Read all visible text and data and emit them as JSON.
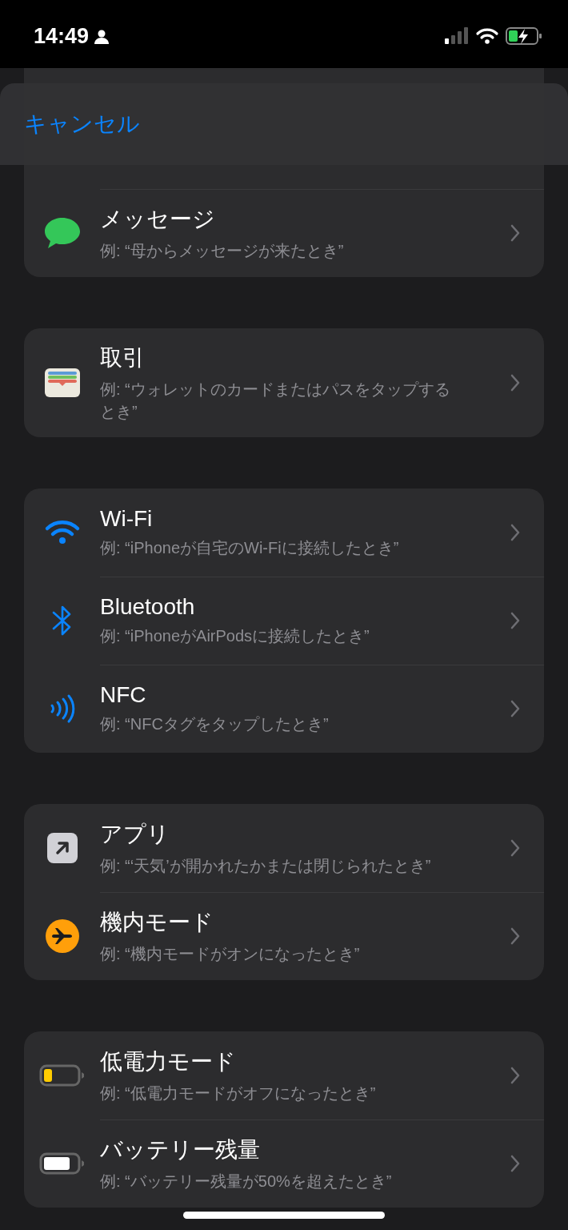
{
  "status_bar": {
    "time": "14:49"
  },
  "header": {
    "cancel": "キャンセル"
  },
  "groups": [
    {
      "rows": [
        {
          "kind": "message",
          "title": "メッセージ",
          "subtitle": "例: “母からメッセージが来たとき”"
        }
      ]
    },
    {
      "rows": [
        {
          "kind": "wallet",
          "title": "取引",
          "subtitle": "例: “ウォレットのカードまたはパスをタップするとき”"
        }
      ]
    },
    {
      "rows": [
        {
          "kind": "wifi",
          "title": "Wi-Fi",
          "subtitle": "例: “iPhoneが自宅のWi-Fiに接続したとき”"
        },
        {
          "kind": "bluetooth",
          "title": "Bluetooth",
          "subtitle": "例: “iPhoneがAirPodsに接続したとき”"
        },
        {
          "kind": "nfc",
          "title": "NFC",
          "subtitle": "例: “NFCタグをタップしたとき”"
        }
      ]
    },
    {
      "rows": [
        {
          "kind": "app",
          "title": "アプリ",
          "subtitle": "例: “‘天気’が開かれたかまたは閉じられたとき”"
        },
        {
          "kind": "airplane",
          "title": "機内モード",
          "subtitle": "例: “機内モードがオンになったとき”"
        }
      ]
    },
    {
      "rows": [
        {
          "kind": "battery_low",
          "title": "低電力モード",
          "subtitle": "例: “低電力モードがオフになったとき”"
        },
        {
          "kind": "battery_full",
          "title": "バッテリー残量",
          "subtitle": "例: “バッテリー残量が50%を超えたとき”"
        }
      ]
    }
  ]
}
